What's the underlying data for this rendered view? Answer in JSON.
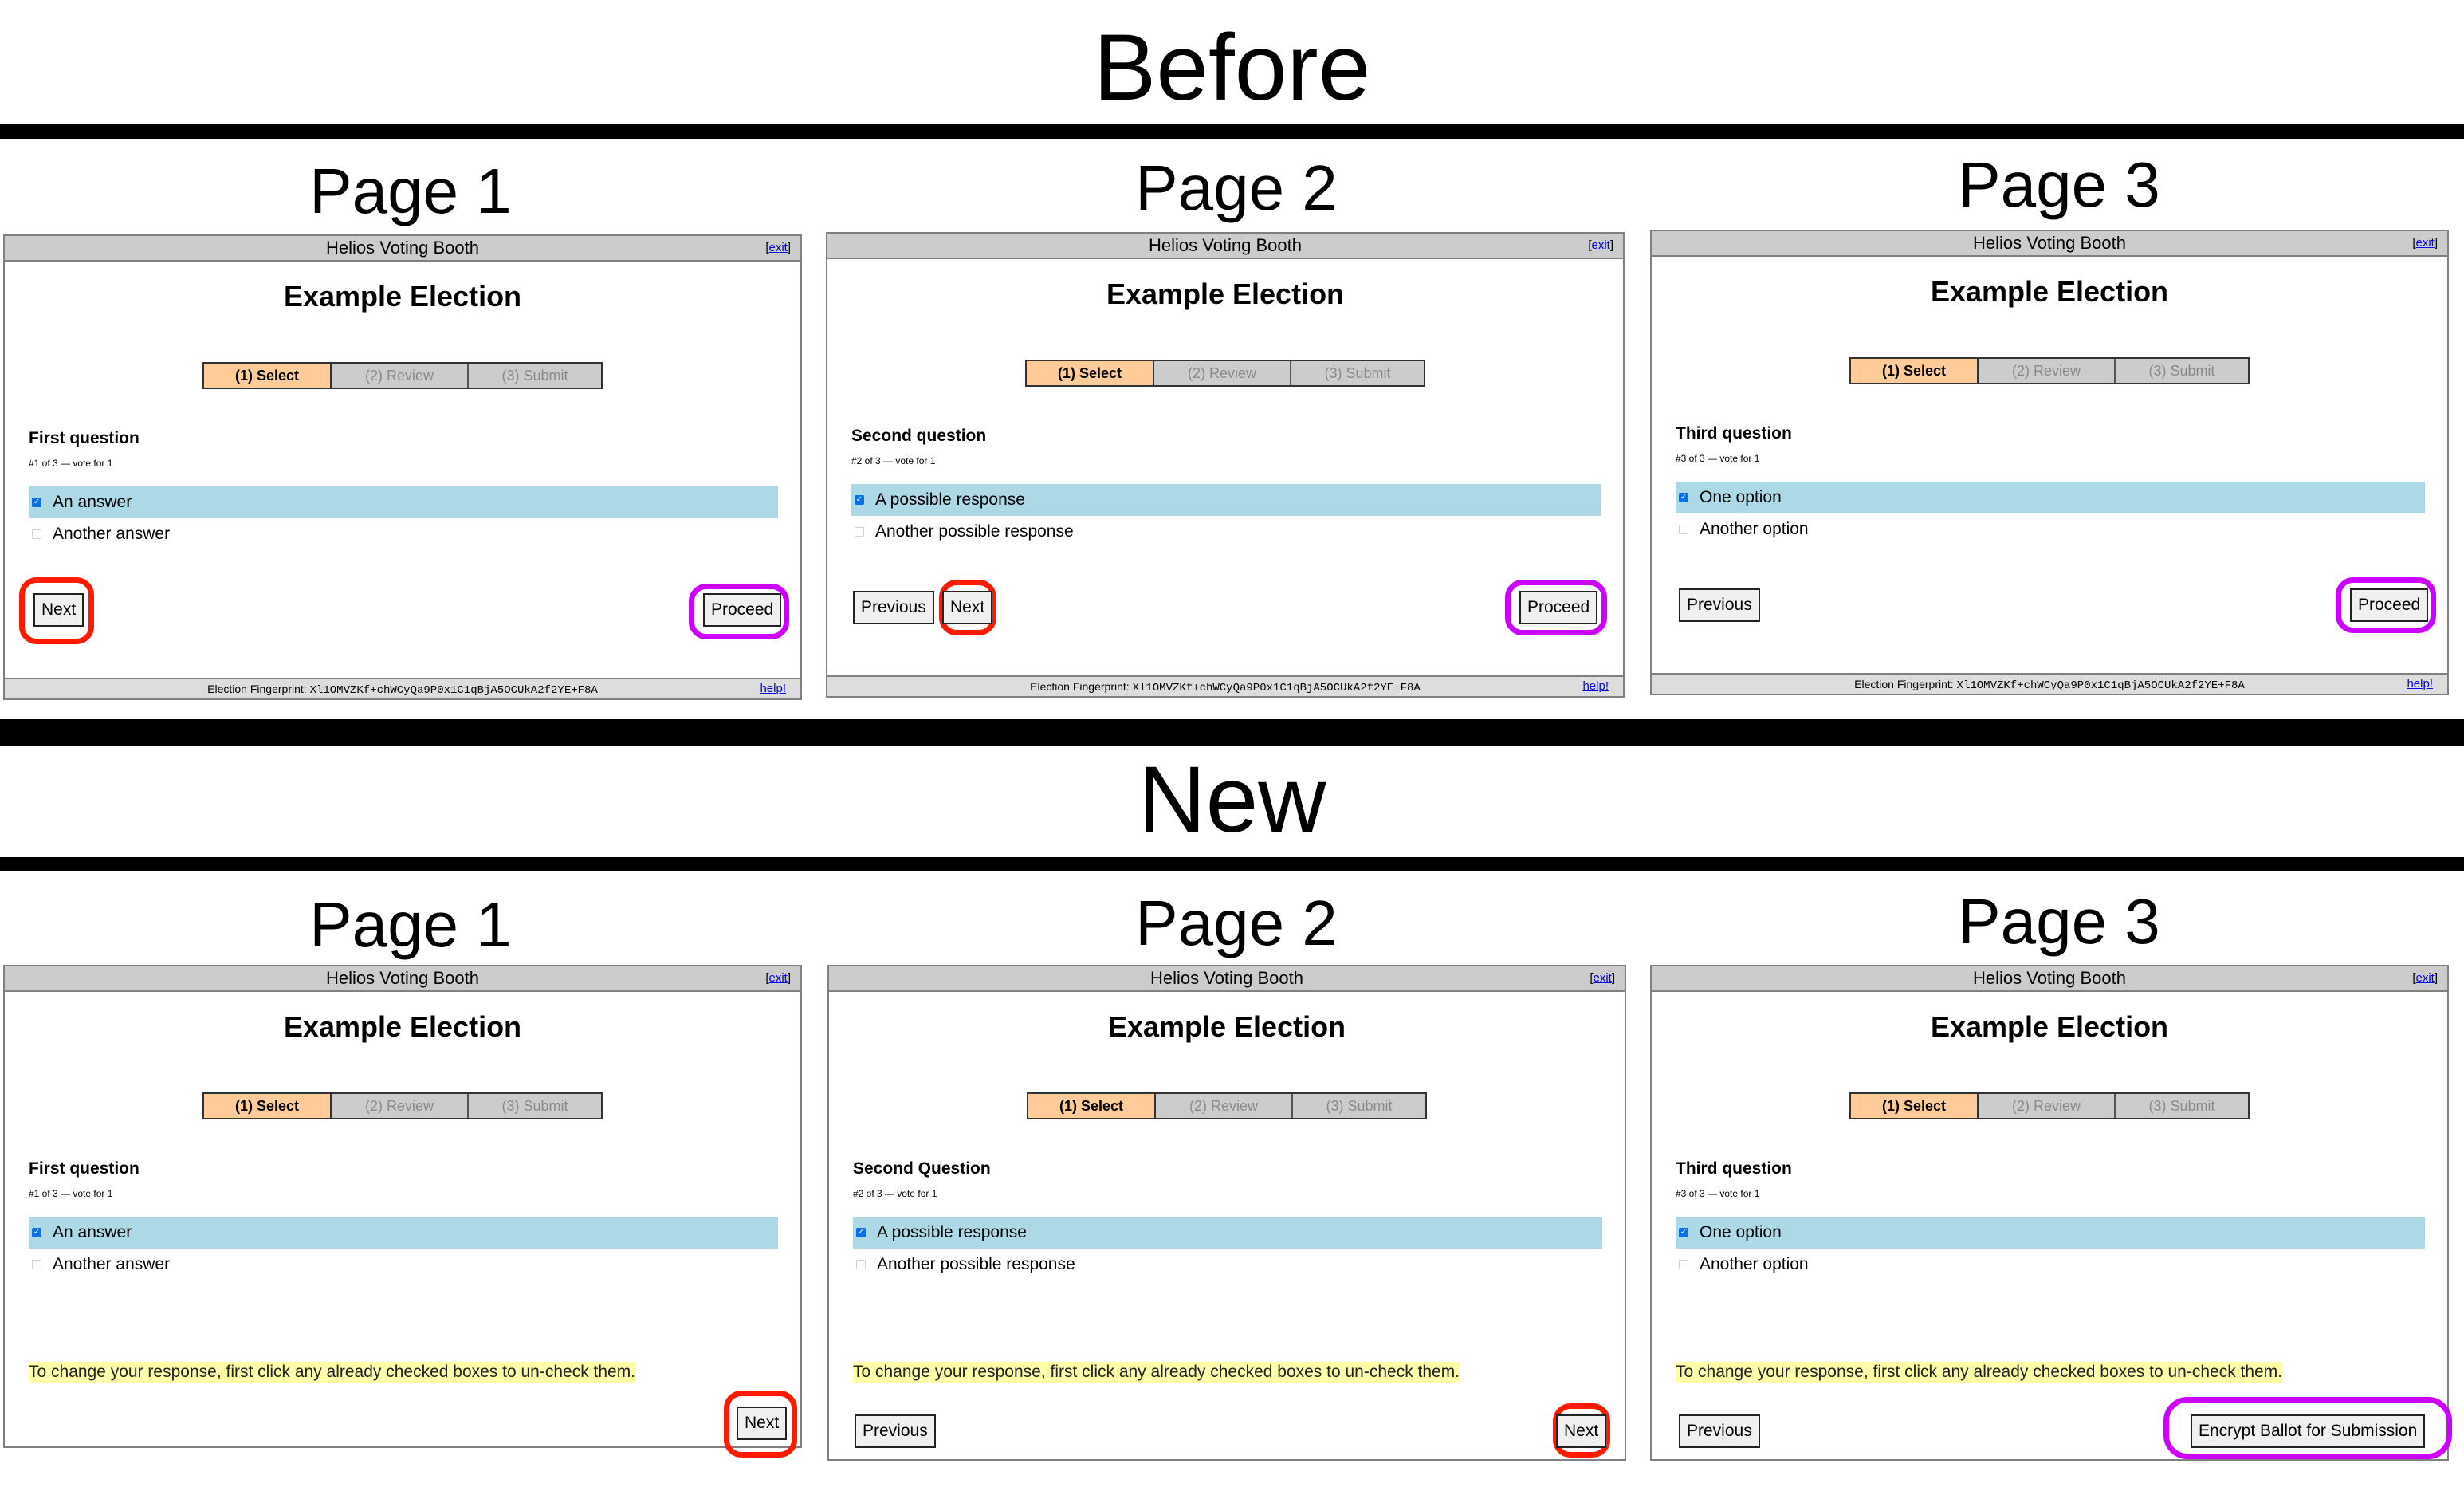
{
  "sections": {
    "before_title": "Before",
    "new_title": "New"
  },
  "colors": {
    "header_bg": "#cccccc",
    "active_tab": "#ffcc99",
    "selected_answer": "#add8e6",
    "hint_bg": "#ffffaa",
    "annotation_red": "#ff1a00",
    "annotation_purple": "#cc00ff"
  },
  "booth": {
    "header_title": "Helios Voting Booth",
    "exit_label": "exit",
    "election_title": "Example Election",
    "tabs": [
      "(1) Select",
      "(2) Review",
      "(3) Submit"
    ],
    "fingerprint_label": "Election Fingerprint:",
    "fingerprint": "Xl1OMVZKf+chWCyQa9P0x1C1qBjA5OCUkA2f2YE+F8A",
    "help_label": "help!",
    "hint": "To change your response, first click any already checked boxes to un-check them."
  },
  "before": [
    {
      "page_label": "Page 1",
      "question": "First question",
      "subtitle": "#1 of 3 — vote for 1",
      "answers": [
        {
          "label": "An answer",
          "checked": true
        },
        {
          "label": "Another answer",
          "checked": false
        }
      ],
      "buttons": {
        "next": "Next",
        "proceed": "Proceed"
      }
    },
    {
      "page_label": "Page 2",
      "question": "Second question",
      "subtitle": "#2 of 3 — vote for 1",
      "answers": [
        {
          "label": "A possible response",
          "checked": true
        },
        {
          "label": "Another possible response",
          "checked": false
        }
      ],
      "buttons": {
        "previous": "Previous",
        "next": "Next",
        "proceed": "Proceed"
      }
    },
    {
      "page_label": "Page 3",
      "question": "Third question",
      "subtitle": "#3 of 3 — vote for 1",
      "answers": [
        {
          "label": "One option",
          "checked": true
        },
        {
          "label": "Another option",
          "checked": false
        }
      ],
      "buttons": {
        "previous": "Previous",
        "proceed": "Proceed"
      }
    }
  ],
  "new": [
    {
      "page_label": "Page 1",
      "question": "First question",
      "subtitle": "#1 of 3 — vote for 1",
      "answers": [
        {
          "label": "An answer",
          "checked": true
        },
        {
          "label": "Another answer",
          "checked": false
        }
      ],
      "buttons": {
        "next": "Next"
      }
    },
    {
      "page_label": "Page 2",
      "question": "Second Question",
      "subtitle": "#2 of 3 — vote for 1",
      "answers": [
        {
          "label": "A possible response",
          "checked": true
        },
        {
          "label": "Another possible response",
          "checked": false
        }
      ],
      "buttons": {
        "previous": "Previous",
        "next": "Next"
      }
    },
    {
      "page_label": "Page 3",
      "question": "Third question",
      "subtitle": "#3 of 3 — vote for 1",
      "answers": [
        {
          "label": "One option",
          "checked": true
        },
        {
          "label": "Another option",
          "checked": false
        }
      ],
      "buttons": {
        "previous": "Previous",
        "encrypt": "Encrypt Ballot for Submission"
      }
    }
  ]
}
